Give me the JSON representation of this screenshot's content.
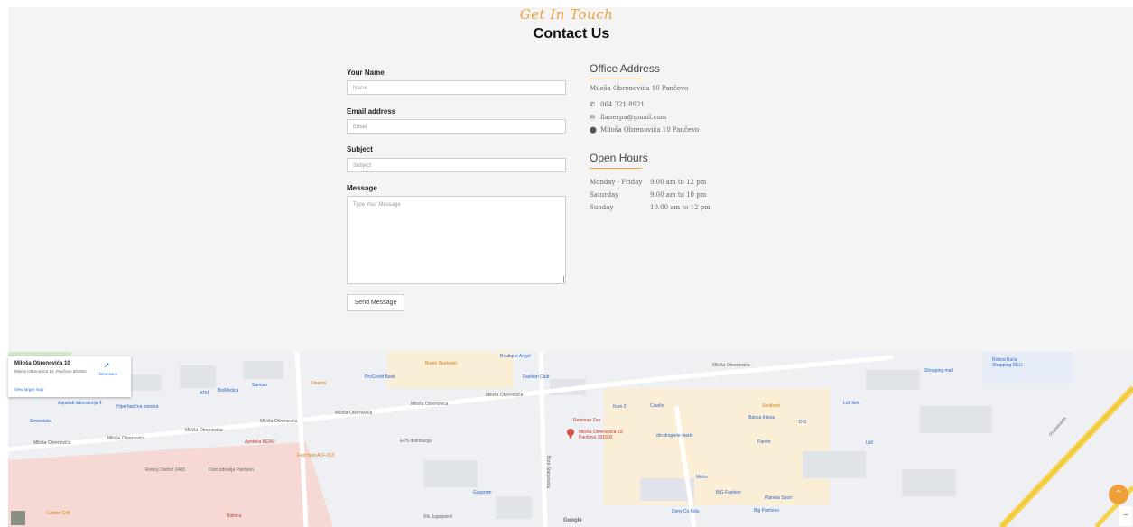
{
  "header": {
    "tagline": "Get In Touch",
    "title": "Contact Us"
  },
  "form": {
    "name_label": "Your Name",
    "name_placeholder": "Name",
    "email_label": "Email address",
    "email_placeholder": "Email",
    "subject_label": "Subject",
    "subject_placeholder": "Subject",
    "message_label": "Message",
    "message_placeholder": "Type Your Message",
    "send_label": "Send Message"
  },
  "office": {
    "title": "Office Address",
    "address": "Miloša Obrenovića 10 Pančevo",
    "phone": "064 321 8921",
    "email": "flanerpa@gmail.com",
    "location": "Miloša Obrenovića 10 Pančevo"
  },
  "hours": {
    "title": "Open Hours",
    "rows": [
      {
        "day": "Monday - Friday",
        "time": "9.00 am to 12 pm"
      },
      {
        "day": "Saturday",
        "time": "9.00 am to 10 pm"
      },
      {
        "day": "Sunday",
        "time": "10.00 am to 12 pm"
      }
    ]
  },
  "map": {
    "card_name": "Miloša Obrenovića 10",
    "card_address": "Miloša Obrenovića 10, Pančevo 301602",
    "directions": "Directions",
    "view_larger": "View larger map",
    "pin_label": "Miloša Obrenovića 10, Pančevo 301602",
    "google": "Google",
    "streets": [
      "Miloša Obrenovića",
      "Miloša Obrenovića",
      "Miloša Obrenovića",
      "Miloša Obrenovića",
      "Miloša Obrenovića",
      "Miloša Obrenovića",
      "Miloša Obrenovića",
      "Miloša Obrenovića",
      "Bore Stankovića",
      "Promenada"
    ],
    "pois": [
      "Burek Starkoski",
      "Boutique Angel",
      "ProCredit Bank",
      "Fashion Club",
      "Samtan",
      "Dinamo",
      "BioMedica",
      "ATM",
      "Aqualab laboratorija 4",
      "Hiperbarična komora",
      "Smrzotaka",
      "Apoteka BENU",
      "Fast food ALF-013",
      "Rotary District 2483",
      "Dom zdravlja Pančevo",
      "EPS distribucija",
      "Restoran Zen",
      "Kum 2",
      "Ciaolle",
      "Banca Intesa",
      "Soulfood",
      "Lufi kids",
      "dm drogerie markt",
      "Panter",
      "Lidl",
      "Metro",
      "BIG Fashion",
      "Planeta Sport",
      "Big Pančevo",
      "Deny Co Kids",
      "Gazprom",
      "Nis Jugopetrol",
      "Bolnica",
      "Gabriel Grill",
      "Robna Kuća Shopping DELI",
      "Shopping mall",
      "DIS"
    ]
  }
}
